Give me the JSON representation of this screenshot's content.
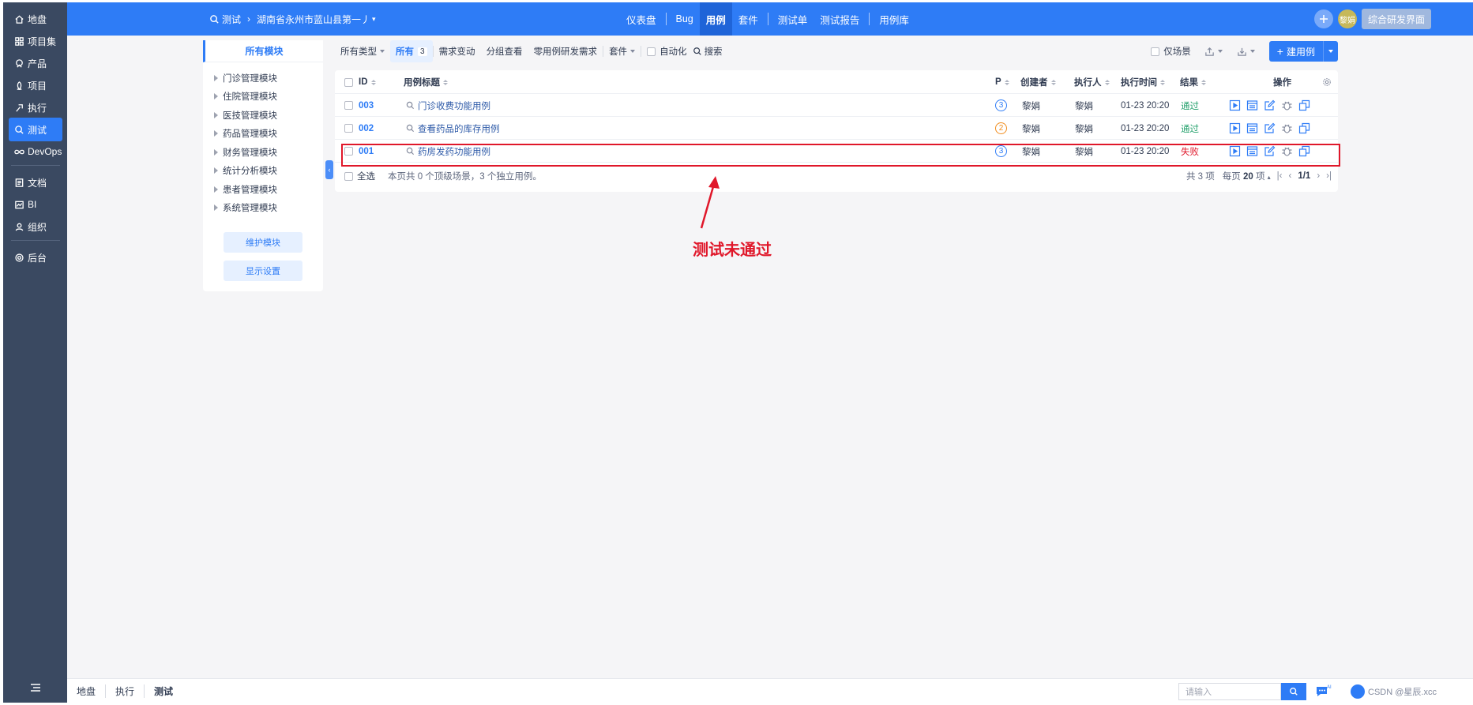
{
  "leftnav": {
    "items": [
      {
        "label": "地盘",
        "icon": "home-icon"
      },
      {
        "label": "项目集",
        "icon": "grid-icon"
      },
      {
        "label": "产品",
        "icon": "product-icon"
      },
      {
        "label": "项目",
        "icon": "project-icon"
      },
      {
        "label": "执行",
        "icon": "run-icon"
      },
      {
        "label": "测试",
        "icon": "test-icon",
        "active": true
      },
      {
        "label": "DevOps",
        "icon": "infinity-icon"
      },
      {
        "label": "文档",
        "icon": "doc-icon"
      },
      {
        "label": "BI",
        "icon": "chart-icon"
      },
      {
        "label": "组织",
        "icon": "org-icon"
      },
      {
        "label": "后台",
        "icon": "gear-icon"
      }
    ]
  },
  "header": {
    "section": "测试",
    "product": "湖南省永州市蓝山县第一丿",
    "tabs": [
      "仪表盘",
      "Bug",
      "用例",
      "套件",
      "测试单",
      "测试报告",
      "用例库"
    ],
    "active_tab": "用例",
    "user": "黎娟",
    "switch_button": "综合研发界面"
  },
  "modules": {
    "title": "所有模块",
    "items": [
      "门诊管理模块",
      "住院管理模块",
      "医技管理模块",
      "药品管理模块",
      "财务管理模块",
      "统计分析模块",
      "患者管理模块",
      "系统管理模块"
    ],
    "maintain_button": "维护模块",
    "display_button": "显示设置"
  },
  "toolbar": {
    "type_filter": "所有类型",
    "all_label": "所有",
    "all_count": "3",
    "need_change": "需求变动",
    "group_view": "分组查看",
    "zero_case": "零用例研发需求",
    "suite": "套件",
    "automation": "自动化",
    "search": "搜索",
    "scene_only": "仅场景",
    "new_case": "建用例"
  },
  "table": {
    "headers": {
      "id": "ID",
      "title": "用例标题",
      "pri": "P",
      "creator": "创建者",
      "executor": "执行人",
      "exec_time": "执行时间",
      "result": "结果",
      "actions": "操作"
    },
    "rows": [
      {
        "id": "003",
        "title": "门诊收费功能用例",
        "pri": "3",
        "creator": "黎娟",
        "executor": "黎娟",
        "exec_time": "01-23 20:20",
        "result": "通过"
      },
      {
        "id": "002",
        "title": "查看药品的库存用例",
        "pri": "2",
        "creator": "黎娟",
        "executor": "黎娟",
        "exec_time": "01-23 20:20",
        "result": "通过"
      },
      {
        "id": "001",
        "title": "药房发药功能用例",
        "pri": "3",
        "creator": "黎娟",
        "executor": "黎娟",
        "exec_time": "01-23 20:20",
        "result": "失败"
      }
    ],
    "footer": {
      "select_all": "全选",
      "summary": "本页共 0 个顶级场景，3 个独立用例。",
      "total": "共 3 项",
      "per_page_label": "每页",
      "per_page": "20",
      "per_page_unit": "项",
      "page": "1/1"
    }
  },
  "annotation": "测试未通过",
  "bottombar": {
    "links": [
      "地盘",
      "执行",
      "测试"
    ],
    "search_placeholder": "请输入",
    "right_text": "CSDN @星辰.xcc"
  },
  "colors": {
    "primary": "#2e7cf6",
    "pass": "#22a06b",
    "fail": "#e0172a",
    "annotation": "#e0172a"
  }
}
